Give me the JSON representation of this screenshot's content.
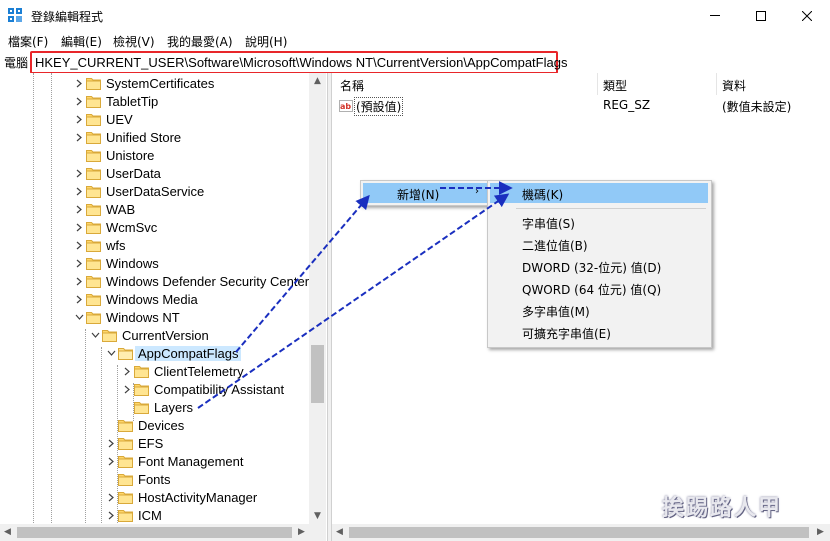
{
  "window": {
    "title": "登錄編輯程式",
    "minimize_glyph": "—",
    "maximize_glyph": "☐",
    "close_glyph": "✕"
  },
  "menu": [
    "檔案(F)",
    "編輯(E)",
    "檢視(V)",
    "我的最愛(A)",
    "說明(H)"
  ],
  "address": {
    "label": "電腦",
    "path": "HKEY_CURRENT_USER\\Software\\Microsoft\\Windows NT\\CurrentVersion\\AppCompatFlags"
  },
  "tree": [
    {
      "label": "SystemCertificates"
    },
    {
      "label": "TabletTip"
    },
    {
      "label": "UEV"
    },
    {
      "label": "Unified Store"
    },
    {
      "label": "Unistore"
    },
    {
      "label": "UserData"
    },
    {
      "label": "UserDataService"
    },
    {
      "label": "WAB"
    },
    {
      "label": "WcmSvc"
    },
    {
      "label": "wfs"
    },
    {
      "label": "Windows"
    },
    {
      "label": "Windows Defender Security Center"
    },
    {
      "label": "Windows Media"
    },
    {
      "label": "Windows NT"
    },
    {
      "label": "CurrentVersion"
    },
    {
      "label": "AppCompatFlags"
    },
    {
      "label": "ClientTelemetry"
    },
    {
      "label": "Compatibility Assistant"
    },
    {
      "label": "Layers"
    },
    {
      "label": "Devices"
    },
    {
      "label": "EFS"
    },
    {
      "label": "Font Management"
    },
    {
      "label": "Fonts"
    },
    {
      "label": "HostActivityManager"
    },
    {
      "label": "ICM"
    }
  ],
  "list": {
    "columns": [
      "名稱",
      "類型",
      "資料"
    ],
    "rows": [
      {
        "icon": "ab",
        "name": "(預設值)",
        "type": "REG_SZ",
        "data": "(數值未設定)"
      }
    ]
  },
  "context_menu": {
    "new_label": "新增(N)",
    "submenu": [
      "機碼(K)",
      "字串值(S)",
      "二進位值(B)",
      "DWORD (32-位元) 值(D)",
      "QWORD (64 位元) 值(Q)",
      "多字串值(M)",
      "可擴充字串值(E)"
    ]
  },
  "watermark": "挨踢路人甲",
  "colors": {
    "highlight": "#91c9f7",
    "address_border": "#e8262a",
    "arrow": "#1a2fbf",
    "folder": "#ffd76a"
  }
}
